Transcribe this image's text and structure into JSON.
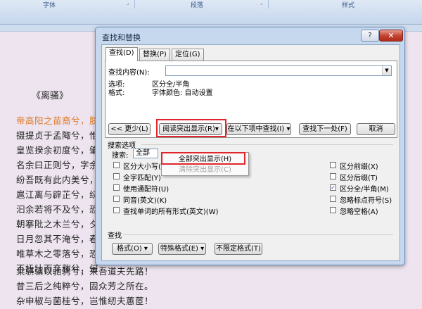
{
  "ribbon": {
    "groups": [
      "字体",
      "段落",
      "样式"
    ]
  },
  "document": {
    "title": "《离骚》",
    "lines": [
      "帝高阳之苗裔兮，朕",
      "摄提贞于孟陬兮，惟",
      "皇览揆余初度兮，肇",
      "名余曰正则兮，字余",
      "纷吾既有此内美兮，",
      "扈江离与辟芷兮，纫",
      "汩余若将不及兮，恐",
      "朝搴阰之木兰兮，夕",
      "日月忽其不淹兮，春",
      "唯草木之零落兮，恐",
      "不抚壮而弃秽兮，何",
      "乘骐骥以驰骋兮，来吾道夫先路！",
      "昔三后之纯粹兮，固众芳之所在。",
      "杂申椒与菌桂兮，岂惟纫夫蕙茝！"
    ]
  },
  "dialog": {
    "title": "查找和替换",
    "help_label": "?",
    "close_label": "✕",
    "tabs": [
      "查找(D)",
      "替换(P)",
      "定位(G)"
    ],
    "find_label": "查找内容(N):",
    "options_label": "选项:",
    "options_value": "区分全/半角",
    "format_label": "格式:",
    "format_value": "字体颜色: 自动设置",
    "less_button": "<< 更少(L)",
    "highlight_button": "阅读突出显示(R)▾",
    "find_in_button": "在以下项中查找(I) ▾",
    "find_next_button": "查找下一处(F)",
    "cancel_button": "取消",
    "menu": {
      "highlight_all": "全部突出显示(H)",
      "clear_highlight": "清除突出显示(C)"
    },
    "search_options_label": "搜索选项",
    "search_label": "搜索:",
    "search_value": "全部",
    "checks_left": [
      {
        "label": "区分大小写(H)",
        "checked": false
      },
      {
        "label": "全字匹配(Y)",
        "checked": false
      },
      {
        "label": "使用通配符(U)",
        "checked": false
      },
      {
        "label": "同音(英文)(K)",
        "checked": false
      },
      {
        "label": "查找单词的所有形式(英文)(W)",
        "checked": false
      }
    ],
    "checks_right": [
      {
        "label": "区分前缀(X)",
        "checked": false
      },
      {
        "label": "区分后缀(T)",
        "checked": false
      },
      {
        "label": "区分全/半角(M)",
        "checked": true
      },
      {
        "label": "忽略标点符号(S)",
        "checked": false
      },
      {
        "label": "忽略空格(A)",
        "checked": false
      }
    ],
    "check_mark": "✓",
    "find_section_label": "查找",
    "format_button": "格式(O) ▾",
    "special_button": "特殊格式(E) ▾",
    "no_format_button": "不限定格式(T)"
  }
}
